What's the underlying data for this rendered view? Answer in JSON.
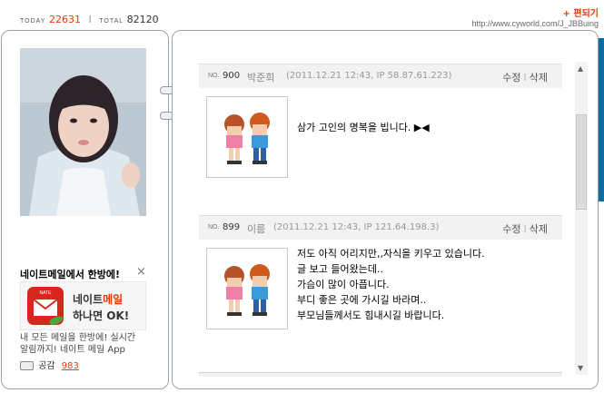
{
  "counter": {
    "today_label": "TODAY",
    "today_value": "22631",
    "separator": "I",
    "total_label": "TOTAL",
    "total_value": "82120"
  },
  "header": {
    "edit_label": "+ 편되기",
    "url": "http://www.cyworld.com/J_JBBuing"
  },
  "ad": {
    "title": "네이트메일에서 한방에!",
    "close": "×",
    "brand": "NATE",
    "banner_line1_a": "네이트",
    "banner_line1_b": "메일",
    "banner_line2": "하나면 OK!",
    "desc_line1": "내 모든 메일을 한방에! 실시간",
    "desc_line2": "알림까지! 네이트 메일 App",
    "sympathy_label": "공감",
    "sympathy_count": "983"
  },
  "entries": [
    {
      "no_label": "NO.",
      "no": "900",
      "author": "박준희",
      "meta": "(2011.12.21 12:43, IP 58.87.61.223)",
      "edit": "수정",
      "delete": "삭제",
      "text": "삼가 고인의 명복을 빕니다. ▶◀"
    },
    {
      "no_label": "NO.",
      "no": "899",
      "author": "이름",
      "meta": "(2011.12.21 12:43, IP 121.64.198.3)",
      "edit": "수정",
      "delete": "삭제",
      "text": "저도 아직 어리지만,,자식을 키우고 있습니다.\n글 보고 들어왔는데..\n가슴이 많이 아픕니다.\n부디 좋은 곳에 가시길 바라며..\n부모님들께서도 힘내시길 바랍니다."
    }
  ],
  "colors": {
    "accent": "#e8390a",
    "border": "#9aa3a9",
    "strip": "#0e6e9e"
  }
}
